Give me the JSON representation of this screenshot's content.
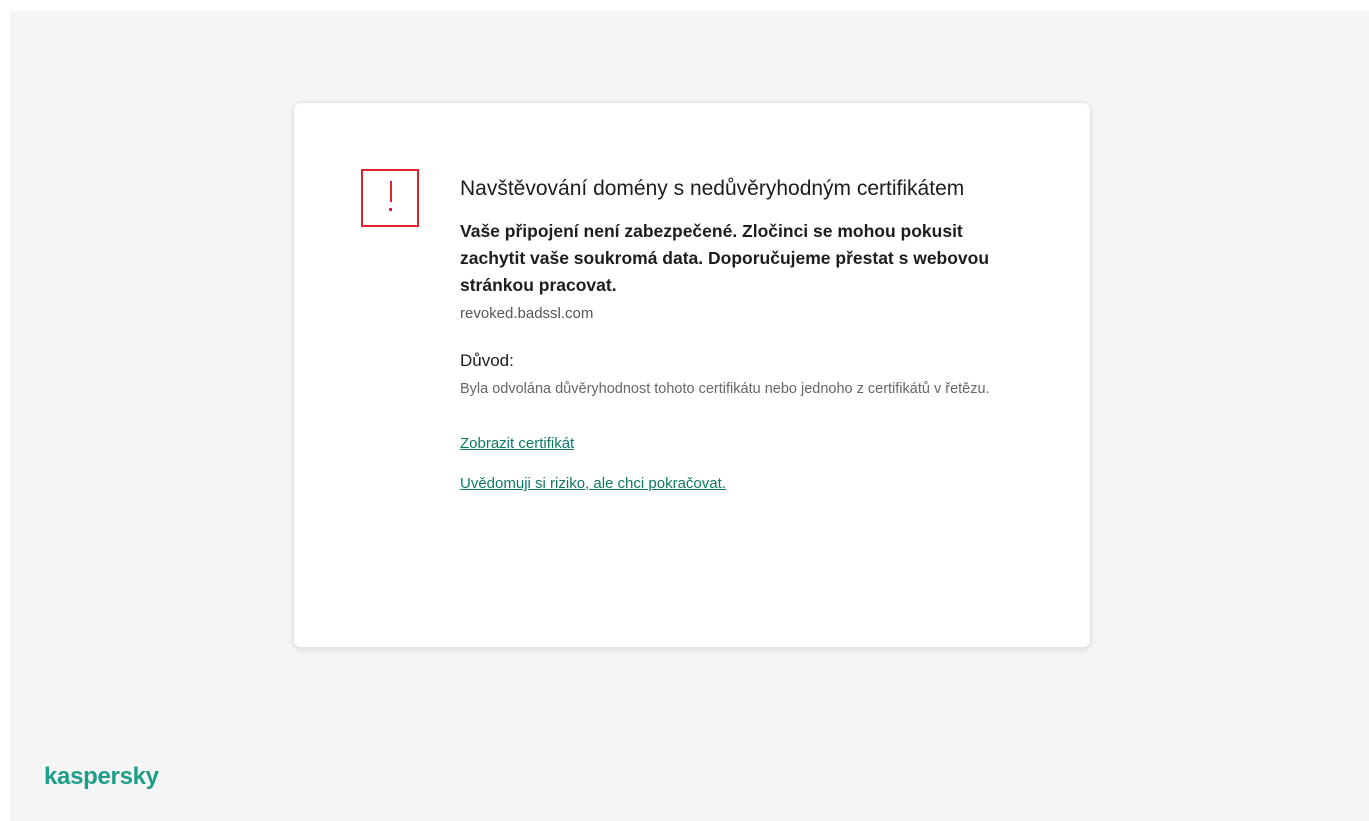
{
  "warning": {
    "title": "Navštěvování domény s nedůvěryhodným certifikátem",
    "lead": "Vaše připojení není zabezpečené. Zločinci se mohou pokusit zachytit vaše soukromá data. Doporučujeme přestat s webovou stránkou pracovat.",
    "domain": "revoked.badssl.com",
    "reason_title": "Důvod:",
    "reason_text": "Byla odvolána důvěryhodnost tohoto certifikátu nebo jednoho z certifikátů v řetězu.",
    "view_certificate_link": "Zobrazit certifikát",
    "continue_link": "Uvědomuji si riziko, ale chci pokračovat.",
    "icon": "warning-exclamation-icon"
  },
  "brand": {
    "name": "kaspersky",
    "color": "#1d9e8a"
  },
  "colors": {
    "alert": "#e0242b",
    "link": "#0e7a66",
    "background": "#f5f5f5",
    "card": "#ffffff"
  }
}
